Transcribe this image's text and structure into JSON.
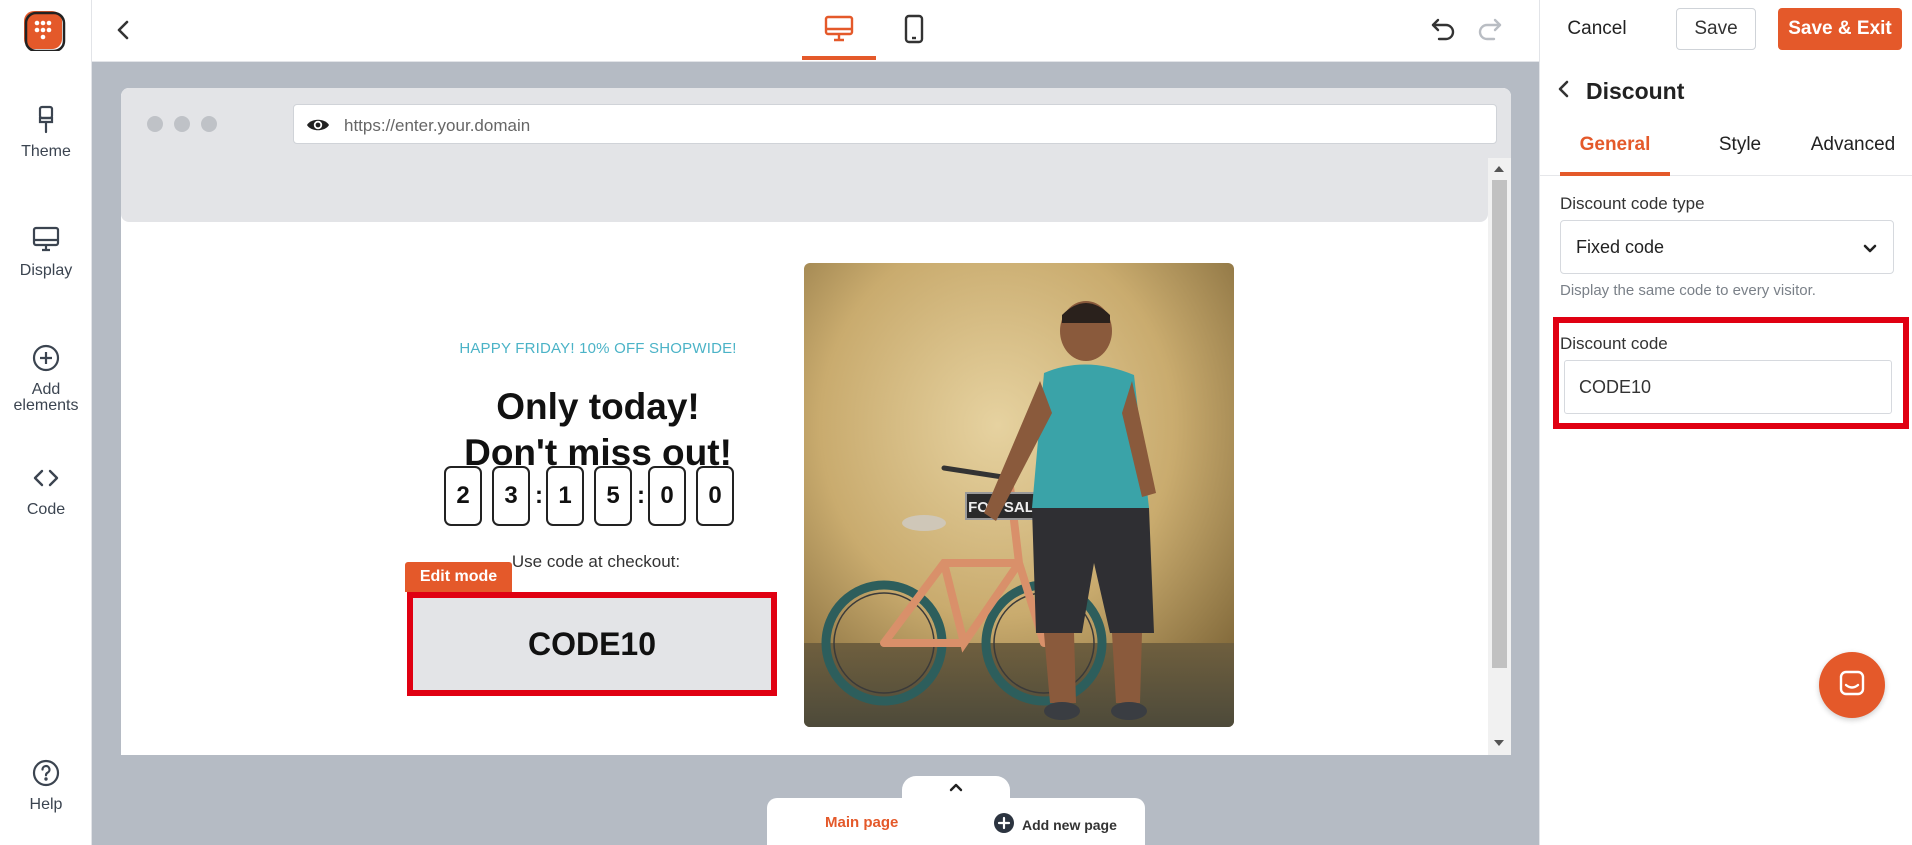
{
  "sidebar": {
    "items": [
      {
        "label": "Theme",
        "icon": "brush-icon"
      },
      {
        "label": "Display",
        "icon": "monitor-icon"
      },
      {
        "label": "Add\nelements",
        "icon": "plus-circle-icon"
      },
      {
        "label": "Code",
        "icon": "code-icon"
      }
    ],
    "help_label": "Help"
  },
  "toolbar": {
    "cancel_label": "Cancel",
    "save_label": "Save",
    "save_exit_label": "Save & Exit",
    "active_device": "desktop"
  },
  "preview": {
    "url": "https://enter.your.domain",
    "popup": {
      "eyebrow": "HAPPY FRIDAY! 10% OFF SHOPWIDE!",
      "headline_line1": "Only today!",
      "headline_line2": "Don't miss out!",
      "countdown": [
        "2",
        "3",
        "1",
        "5",
        "0",
        "0"
      ],
      "use_code_text": "Use code at checkout:",
      "edit_mode_label": "Edit mode",
      "code": "CODE10",
      "photo_sign_text": "FOR SALE"
    }
  },
  "pages": {
    "main_label": "Main page",
    "add_label": "Add new page"
  },
  "panel": {
    "title": "Discount",
    "tabs": [
      "General",
      "Style",
      "Advanced"
    ],
    "active_tab": "General",
    "code_type_label": "Discount code type",
    "code_type_value": "Fixed code",
    "code_type_hint": "Display the same code to every visitor.",
    "code_label": "Discount code",
    "code_value": "CODE10"
  },
  "colors": {
    "accent": "#e4592a",
    "highlight": "#e00012",
    "eyebrow": "#4bb3c7",
    "canvas": "#b5bbc4"
  }
}
